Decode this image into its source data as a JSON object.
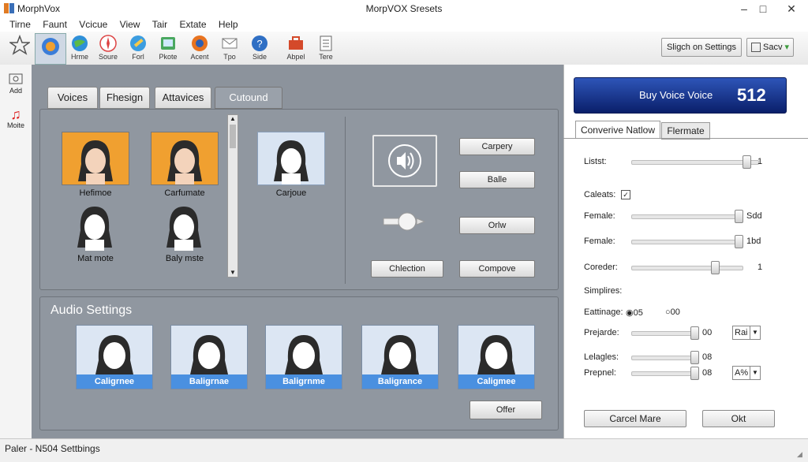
{
  "window": {
    "app_name": "MorphVox",
    "title": "MorpVOX Sresets"
  },
  "menu": [
    "Tirne",
    "Faunt",
    "Vcicue",
    "View",
    "Tair",
    "Extate",
    "Help"
  ],
  "toolbar": {
    "tools": [
      {
        "label": "",
        "icon": "star-icon"
      },
      {
        "label": "",
        "icon": "voice-globe-icon"
      },
      {
        "label": "Hrme",
        "icon": "globe-icon"
      },
      {
        "label": "Soure",
        "icon": "compass-icon"
      },
      {
        "label": "Forl",
        "icon": "pencil-icon"
      },
      {
        "label": "Pkote",
        "icon": "photo-icon"
      },
      {
        "label": "Acent",
        "icon": "browser-icon"
      },
      {
        "label": "Tpo",
        "icon": "envelope-icon"
      },
      {
        "label": "Side",
        "icon": "help-icon"
      },
      {
        "label": "Abpel",
        "icon": "toolbox-icon"
      },
      {
        "label": "Tere",
        "icon": "notes-icon"
      }
    ],
    "settings_button": "Sligch on Settings",
    "save_button": "Sacv"
  },
  "left_dock": [
    {
      "label": "Add",
      "icon": "add-voice-icon"
    },
    {
      "label": "Moite",
      "icon": "music-note-icon"
    }
  ],
  "tabs": [
    "Voices",
    "Fhesign",
    "Attavices",
    "Cutound"
  ],
  "voices": [
    {
      "label": "Hefimoe",
      "style": "orange"
    },
    {
      "label": "Carfumate",
      "style": "orange"
    },
    {
      "label": "Carjoue",
      "style": "blue"
    },
    {
      "label": "Mat mote",
      "style": "blank"
    },
    {
      "label": "Baly mste",
      "style": "blank"
    }
  ],
  "controls": {
    "buttons": [
      "Carpery",
      "Balle",
      "Orlw",
      "Compove"
    ],
    "collection_button": "Chlection"
  },
  "audio_settings": {
    "title": "Audio Settings",
    "cards": [
      "Caligrnee",
      "Baligrnae",
      "Baligrnme",
      "Baligrance",
      "Caligmee"
    ],
    "offer_button": "Offer"
  },
  "right": {
    "buy_banner": {
      "text": "Buy Voice Voice",
      "number": "512"
    },
    "tabs": [
      "Converive Natlow",
      "Flermate"
    ],
    "rows": [
      {
        "label": "Listst:",
        "value": "1",
        "level": 0.93
      },
      {
        "label": "Caleats:",
        "checkbox": true
      },
      {
        "label": "Female:",
        "value": "Sdd",
        "level": 1.0
      },
      {
        "label": "Female:",
        "value": "1bd",
        "level": 1.0
      },
      {
        "label": "Coreder:",
        "value": "1",
        "level": 0.77
      }
    ],
    "simplires": "Simplires:",
    "eattinage": {
      "label": "Eattinage:",
      "opt1": "05",
      "opt2": "00"
    },
    "prejarde": {
      "label": "Prejarde:",
      "value": "00",
      "select": "Rai",
      "level": 1.0
    },
    "lelagles": {
      "label": "Lelagles:",
      "value": "08",
      "level": 1.0
    },
    "prepnel": {
      "label": "Prepnel:",
      "value": "08",
      "select": "A%",
      "level": 1.0
    },
    "cancel_button": "Carcel Mare",
    "ok_button": "Okt"
  },
  "status": "Paler - N504 Settbings"
}
